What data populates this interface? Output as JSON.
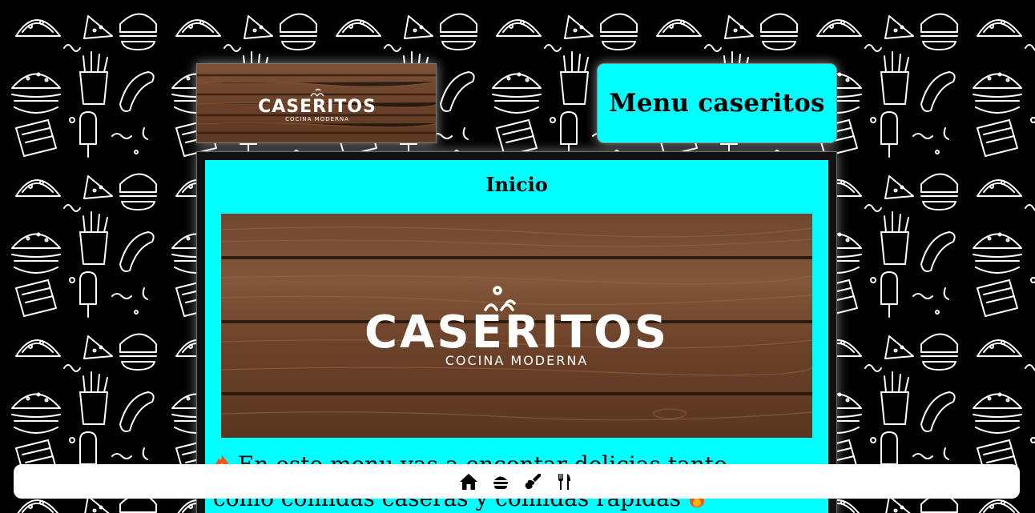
{
  "header": {
    "menu_title": "Menu caseritos"
  },
  "brand": {
    "logo_name": "CASERITOS",
    "logo_tagline": "COCINA MODERNA"
  },
  "main": {
    "section_title": "Inicio",
    "intro_text": "En este menu vas a encontar delicias tanto como comidas caseras y comidas rapidas"
  },
  "bottom_nav": {
    "items": [
      {
        "icon": "home-icon"
      },
      {
        "icon": "burger-icon"
      },
      {
        "icon": "guitar-icon"
      },
      {
        "icon": "utensils-icon"
      }
    ]
  },
  "colors": {
    "accent": "#00ffff",
    "background": "#000000",
    "nav_background": "#ffffff",
    "wood": "#7a4a2a"
  }
}
